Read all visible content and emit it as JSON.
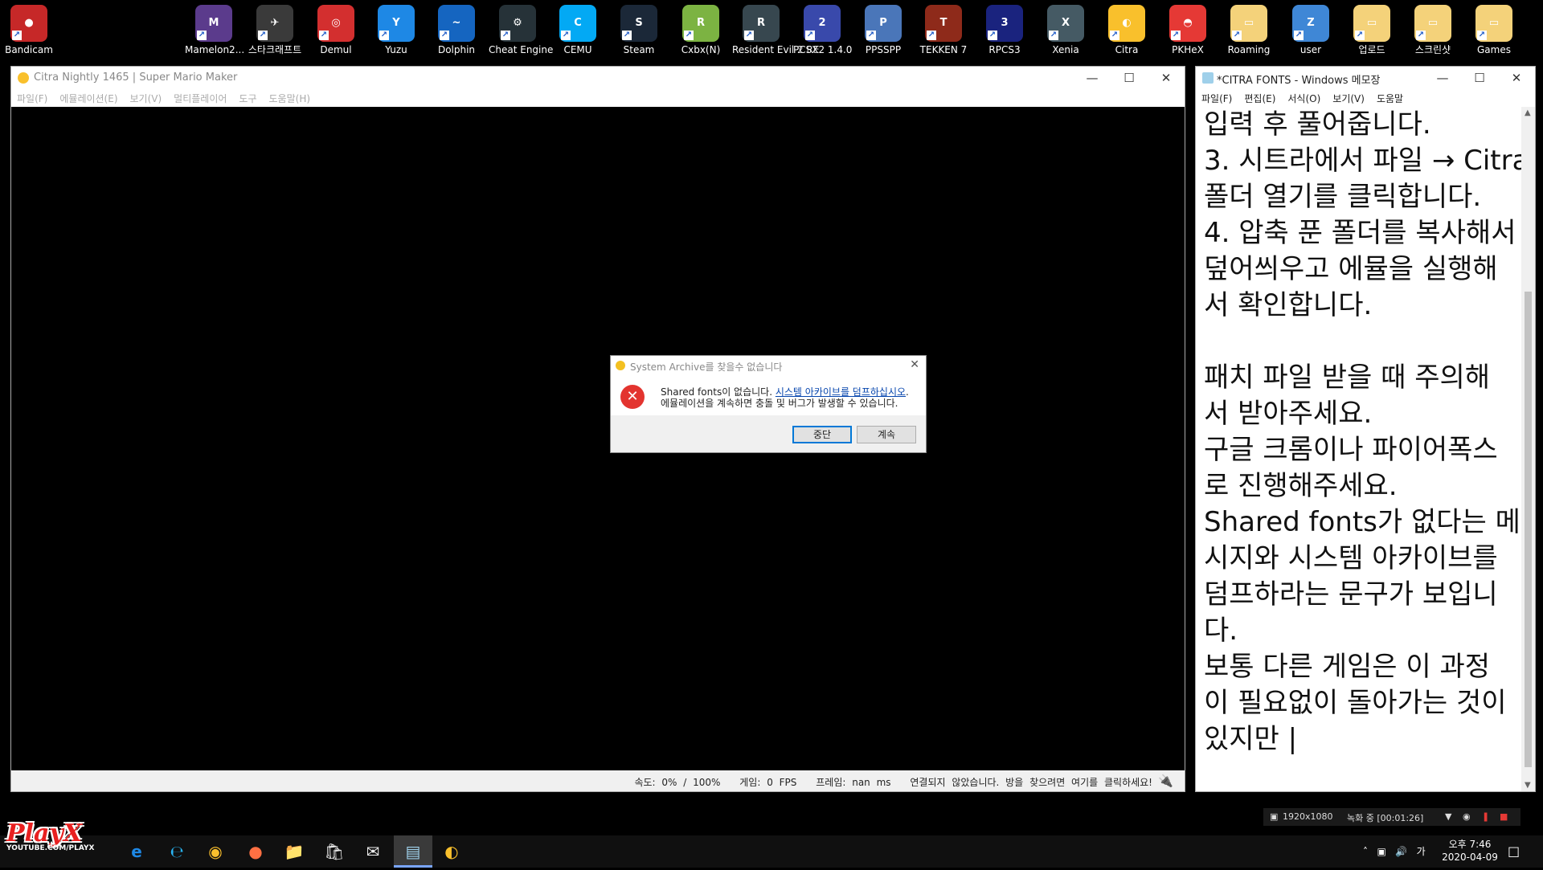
{
  "desktop_icons": [
    {
      "label": "Bandicam",
      "color": "#c62828",
      "glyph": "●"
    },
    {
      "label": "Mamelon2...",
      "color": "#5b3b8c",
      "glyph": "M"
    },
    {
      "label": "스타크래프트",
      "color": "#3a3a3a",
      "glyph": "✈"
    },
    {
      "label": "Demul",
      "color": "#d32f2f",
      "glyph": "◎"
    },
    {
      "label": "Yuzu",
      "color": "#1e88e5",
      "glyph": "Y"
    },
    {
      "label": "Dolphin",
      "color": "#1565c0",
      "glyph": "~"
    },
    {
      "label": "Cheat Engine",
      "color": "#263238",
      "glyph": "⚙"
    },
    {
      "label": "CEMU",
      "color": "#03a9f4",
      "glyph": "C"
    },
    {
      "label": "Steam",
      "color": "#1b2838",
      "glyph": "S"
    },
    {
      "label": "Cxbx(N)",
      "color": "#7cb342",
      "glyph": "R"
    },
    {
      "label": "Resident Evil 2 RE",
      "color": "#37474f",
      "glyph": "R"
    },
    {
      "label": "PCSX2 1.4.0",
      "color": "#3949ab",
      "glyph": "2"
    },
    {
      "label": "PPSSPP",
      "color": "#4a76b9",
      "glyph": "P"
    },
    {
      "label": "TEKKEN 7",
      "color": "#8e2a1a",
      "glyph": "T"
    },
    {
      "label": "RPCS3",
      "color": "#1a237e",
      "glyph": "3"
    },
    {
      "label": "Xenia",
      "color": "#455a64",
      "glyph": "X"
    },
    {
      "label": "Citra",
      "color": "#f9c02c",
      "glyph": "◐"
    },
    {
      "label": "PKHeX",
      "color": "#e53935",
      "glyph": "◓"
    },
    {
      "label": "Roaming",
      "color": "#f4d27a",
      "glyph": "▭"
    },
    {
      "label": "user",
      "color": "#3f87d6",
      "glyph": "Z"
    },
    {
      "label": "업로드",
      "color": "#f4d27a",
      "glyph": "▭"
    },
    {
      "label": "스크린샷",
      "color": "#f4d27a",
      "glyph": "▭"
    },
    {
      "label": "Games",
      "color": "#f4d27a",
      "glyph": "▭"
    }
  ],
  "citra": {
    "title": "Citra Nightly 1465 | Super Mario Maker",
    "menu": [
      "파일(F)",
      "에뮬레이션(E)",
      "보기(V)",
      "멀티플레이어",
      "도구",
      "도움말(H)"
    ],
    "status": {
      "speed": "속도: 0% / 100%",
      "game": "게임: 0 FPS",
      "frame": "프레임: nan ms",
      "net": "연결되지 않았습니다. 방을 찾으려면 여기를 클릭하세요!"
    }
  },
  "dialog": {
    "title": "System Archive를 찾을수 없습니다",
    "line1_prefix": "Shared fonts이 없습니다. ",
    "line1_link": "시스템 아카이브를 덤프하십시오",
    "line1_suffix": ".",
    "line2": "에뮬레이션을 계속하면 충돌 및 버그가 발생할 수 있습니다.",
    "abort": "중단",
    "continue": "계속"
  },
  "notepad": {
    "title": "*CITRA FONTS - Windows 메모장",
    "menu": [
      "파일(F)",
      "편집(E)",
      "서식(O)",
      "보기(V)",
      "도움말"
    ],
    "lines": [
      "입력 후 풀어줍니다.",
      "3. 시트라에서 파일 → Citra",
      "폴더 열기를 클릭합니다.",
      "4. 압축 푼 폴더를 복사해서",
      "덮어씌우고 에뮬을 실행해",
      "서 확인합니다.",
      "",
      "패치 파일 받을 때 주의해",
      "서 받아주세요.",
      "구글 크롬이나 파이어폭스",
      "로 진행해주세요.",
      "Shared fonts가 없다는 메",
      "시지와 시스템 아카이브를",
      "덤프하라는 문구가 보입니",
      "다.",
      "보통 다른 게임은 이 과정",
      "이 필요없이 돌아가는 것이",
      "있지만 |"
    ]
  },
  "bandicam": {
    "resolution": "1920x1080",
    "recording": "녹화 중 [00:01:26]"
  },
  "tray": {
    "time": "오후 7:46",
    "date": "2020-04-09",
    "ime": "가"
  },
  "watermark": {
    "brand": "PlayX",
    "sub": "YOUTUBE.COM/PLAYX"
  }
}
